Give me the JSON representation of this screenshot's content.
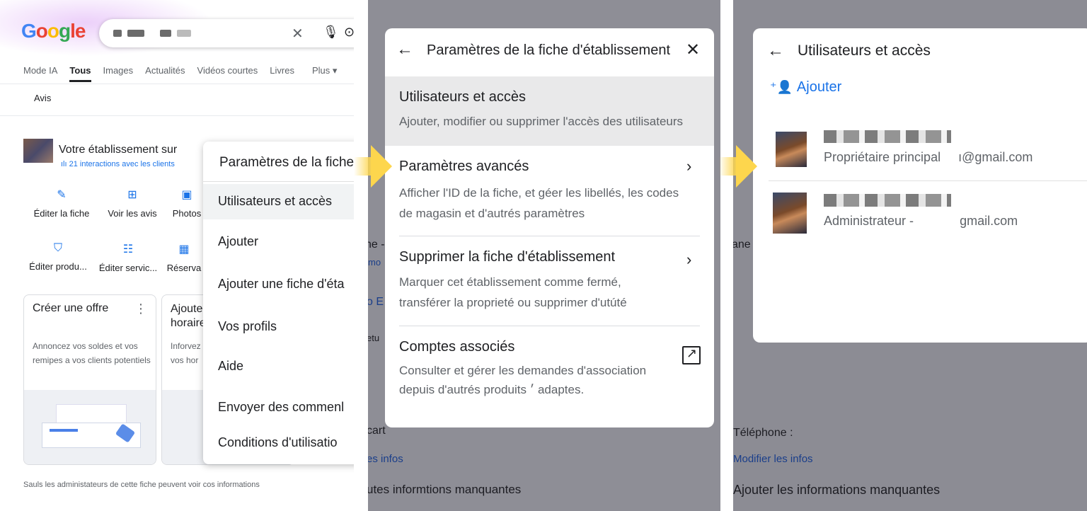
{
  "panel1": {
    "logo": [
      "G",
      "o",
      "o",
      "g",
      "le"
    ],
    "tabs": [
      "Mode IA",
      "Tous",
      "Images",
      "Actualités",
      "Vidéos courtes",
      "Livres",
      "Plus ▾"
    ],
    "subtab": "Avis",
    "business_title": "Votre établissement sur",
    "interactions": "21 interactions avec les clients",
    "actions": [
      {
        "label": "Éditer la fiche",
        "icon": "pencil-icon"
      },
      {
        "label": "Voir les avis",
        "icon": "review-icon"
      },
      {
        "label": "Photos",
        "icon": "photo-icon"
      },
      {
        "label": "Éditer produ...",
        "icon": "bag-icon"
      },
      {
        "label": "Éditer servic...",
        "icon": "list-icon"
      },
      {
        "label": "Réserva",
        "icon": "calendar-icon"
      }
    ],
    "cards": [
      {
        "title": "Créer une offre",
        "desc": "Annoncez vos soldes et vos remipes a vos clients potentiels"
      },
      {
        "title": "Ajoute horaire",
        "desc": "Inforvez vos hor"
      }
    ],
    "footer": "Sauls les administateurs de cette fiche peuvent voir cos informations",
    "menu": {
      "title": "Paramètres de la fiche",
      "items": [
        "Utilisateurs et accès",
        "Ajouter",
        "Ajouter une fiche d'éta",
        "Vos profils",
        "Aide",
        "Envoyer des commenl",
        "Conditions d'utilisatio"
      ]
    }
  },
  "panel2": {
    "dialog_title": "Paramètres de la fiche d'établissement",
    "options": [
      {
        "title": "Utilisateurs et accès",
        "desc": "Ajouter, modifier ou supprimer l'accès des utilisateurs"
      },
      {
        "title": "Paramètres avancés",
        "desc": "Afficher l'ID de la fiche, et géer les libellés, les codes de magasin et d'autrés paramètres"
      },
      {
        "title": "Supprimer la fiche d'établissement",
        "desc": "Marquer cet établissement comme fermé, transférer la proprieté ou supprimer d'utúté"
      },
      {
        "title": "Comptes associés",
        "desc": "Consulter et gérer les demandes d'association depuis d'autrés produits ׳ adaptes."
      }
    ],
    "bg": {
      "ne": "ne -",
      "mo": "mo",
      "o_e": "o E",
      "retu": "etu",
      "cart": "cart",
      "infos": "es infos",
      "missing": "utes informtions manquantes"
    }
  },
  "panel3": {
    "dialog_title": "Utilisateurs et accès",
    "add_label": "Ajouter",
    "users": [
      {
        "role": "Propriétaire principal",
        "email": "ı@gmail.com"
      },
      {
        "role": "Administrateur -",
        "email": "gmail.com"
      }
    ],
    "bg": {
      "ane": "ane",
      "telephone": "Téléphone :",
      "modifier": "Modifier les infos",
      "missing": "Ajouter les informations manquantes"
    }
  }
}
